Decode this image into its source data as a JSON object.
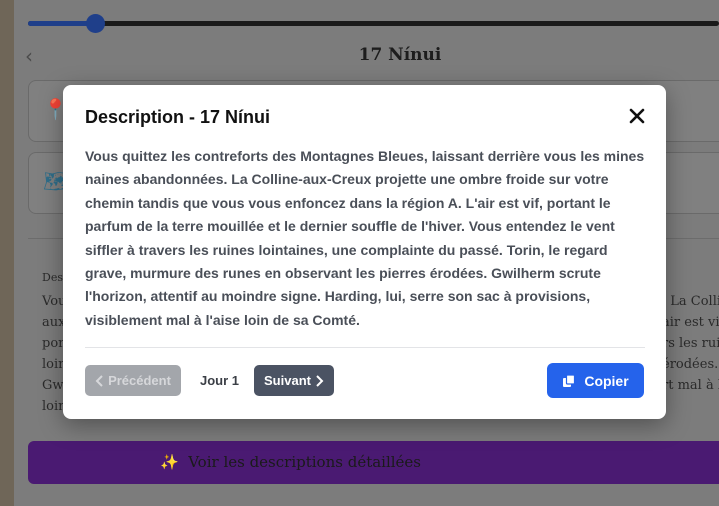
{
  "background": {
    "title": "17 Nínui",
    "card1_icon": "pin-icon",
    "card2_icon": "map-icon",
    "section_label": "Des",
    "left_text_lines": [
      "Vou",
      "aux",
      "por",
      "loin",
      "Gwi",
      "loin"
    ],
    "right_text_lines": [
      ". La Colli",
      "air est vi",
      "rs les rui",
      "érodées.",
      "rt mal à l"
    ],
    "details_button": {
      "icon": "✨",
      "label": "Voir les descriptions détaillées"
    },
    "colors": {
      "accent": "#1f3f8a",
      "button": "#4a1a72"
    }
  },
  "modal": {
    "title": "Description - 17 Nínui",
    "close_icon": "close-icon",
    "description": "Vous quittez les contreforts des Montagnes Bleues, laissant derrière vous les mines naines abandonnées. La Colline-aux-Creux projette une ombre froide sur votre chemin tandis que vous vous enfoncez dans la région A. L'air est vif, portant le parfum de la terre mouillée et le dernier souffle de l'hiver. Vous entendez le vent siffler à travers les ruines lointaines, une complainte du passé. Torin, le regard grave, murmure des runes en observant les pierres érodées. Gwilherm scrute l'horizon, attentif au moindre signe. Harding, lui, serre son sac à provisions, visiblement mal à l'aise loin de sa Comté.",
    "prev_label": "Précédent",
    "day_label": "Jour 1",
    "next_label": "Suivant",
    "copy_label": "Copier",
    "colors": {
      "copy": "#2563eb",
      "next": "#4b5363",
      "prev_disabled": "#a3a6ab"
    }
  }
}
